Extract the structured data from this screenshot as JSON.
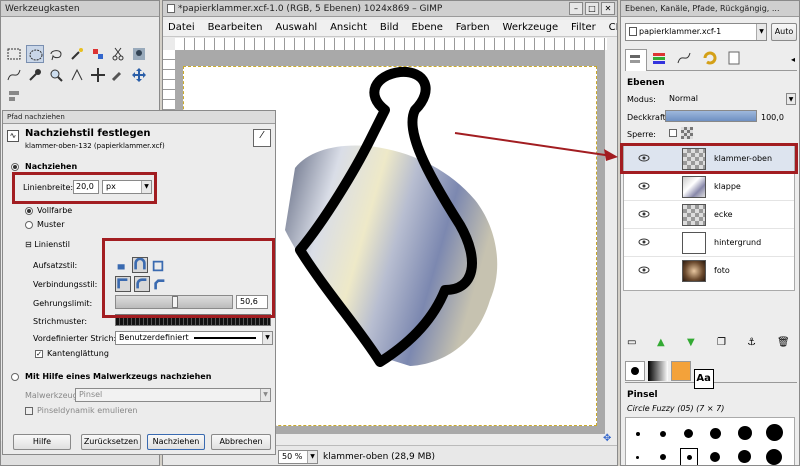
{
  "toolbox": {
    "title": "Werkzeugkasten"
  },
  "image_window": {
    "title": "*papierklammer.xcf-1.0 (RGB, 5 Ebenen) 1024x869 – GIMP",
    "menu": [
      "Datei",
      "Bearbeiten",
      "Auswahl",
      "Ansicht",
      "Bild",
      "Ebene",
      "Farben",
      "Werkzeuge",
      "Filter",
      "CFU"
    ],
    "status": {
      "zoom": "50 %",
      "layer": "klammer-oben (28,9 MB)"
    }
  },
  "dialog": {
    "title": "Pfad nachziehen",
    "heading": "Nachziehstil festlegen",
    "subheading": "klammer-oben-132 (papierklammer.xcf)",
    "stroke_line": "Nachziehen",
    "line_width_label": "Linienbreite:",
    "line_width_value": "20,0",
    "unit": "px",
    "solid": "Vollfarbe",
    "pattern": "Muster",
    "line_style": "Linienstil",
    "cap_label": "Aufsatzstil:",
    "join_label": "Verbindungsstil:",
    "miter_label": "Gehrungslimit:",
    "miter_value": "50,6",
    "dash_label": "Strichmuster:",
    "preset_label": "Vordefinierter Strich:",
    "preset_value": "Benutzerdefiniert",
    "antialias": "Kantenglättung",
    "paint_tool_option": "Mit Hilfe eines Malwerkzeugs nachziehen",
    "paint_tool_label": "Malwerkzeug:",
    "paint_tool_value": "Pinsel",
    "emulate": "Pinseldynamik emulieren",
    "buttons": {
      "help": "Hilfe",
      "reset": "Zurücksetzen",
      "stroke": "Nachziehen",
      "cancel": "Abbrechen"
    }
  },
  "layers_dock": {
    "title": "Ebenen, Kanäle, Pfade, Rückgängig, ...",
    "image_select": "papierklammer.xcf-1",
    "auto": "Auto",
    "panel_title": "Ebenen",
    "mode_label": "Modus:",
    "mode_value": "Normal",
    "opacity_label": "Deckkraft:",
    "opacity_value": "100,0",
    "lock_label": "Sperre:",
    "layers": [
      "klammer-oben",
      "klappe",
      "ecke",
      "hintergrund",
      "foto"
    ],
    "brushes_title": "Pinsel",
    "brush_name": "Circle Fuzzy (05) (7 × 7)"
  }
}
